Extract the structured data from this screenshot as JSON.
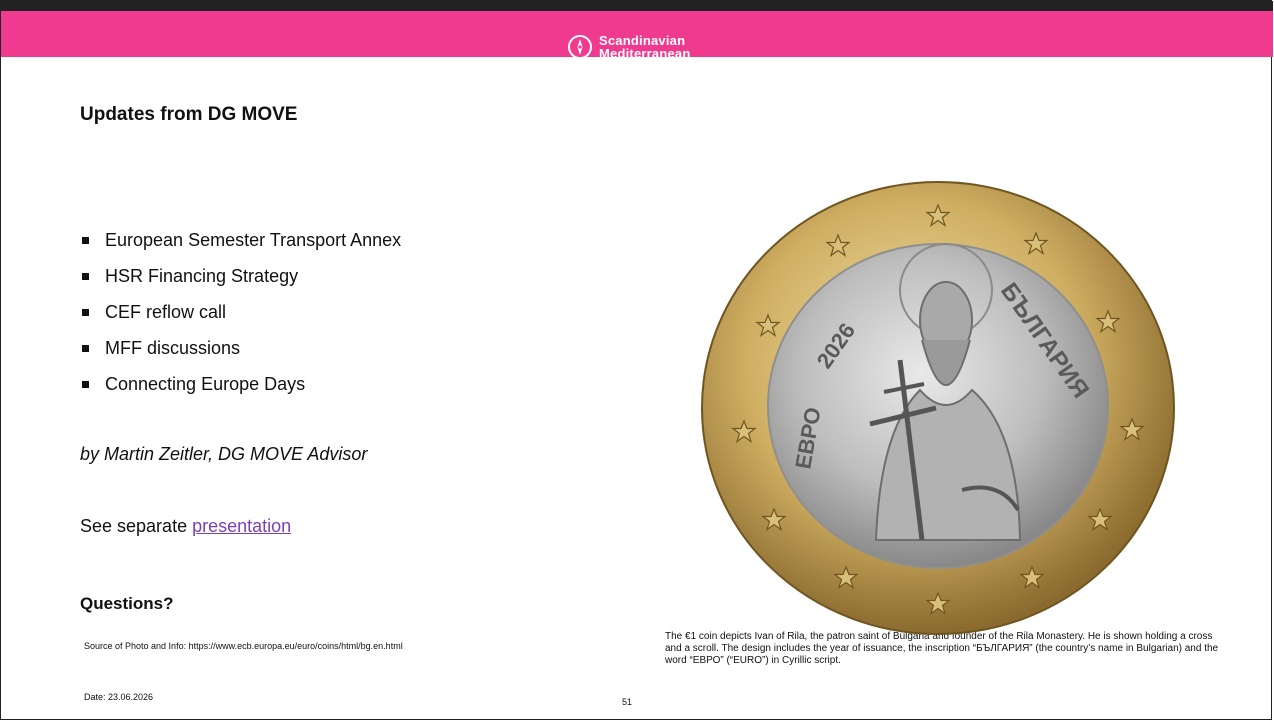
{
  "header": {
    "brand_line1": "Scandinavian",
    "brand_line2": "Mediterranean",
    "bar_color": "#f03a90"
  },
  "slide": {
    "title": "Updates from DG MOVE",
    "bullets": [
      "European Semester Transport Annex",
      "HSR Financing Strategy",
      "CEF reflow call",
      "MFF discussions",
      "Connecting Europe Days"
    ],
    "author": "by Martin Zeitler, DG MOVE Advisor",
    "see_prefix": "See separate ",
    "see_link": "presentation",
    "questions": "Questions?",
    "source": "Source of Photo and Info: https://www.ecb.europa.eu/euro/coins/html/bg.en.html",
    "date": "Date: 23.06.2026",
    "page_number": "51",
    "caption": "The €1 coin depicts Ivan of Rila, the patron saint of Bulgaria and founder of the Rila Monastery. He is shown holding a cross and a scroll. The design includes the year of issuance, the inscription “БЪЛГАРИЯ” (the country’s name in Bulgarian) and the word “ЕВРО” (“EURO”) in Cyrillic script."
  },
  "coin": {
    "year": "2026",
    "currency_word": "ЕВРО",
    "country_word": "БЪЛГАРИЯ"
  }
}
